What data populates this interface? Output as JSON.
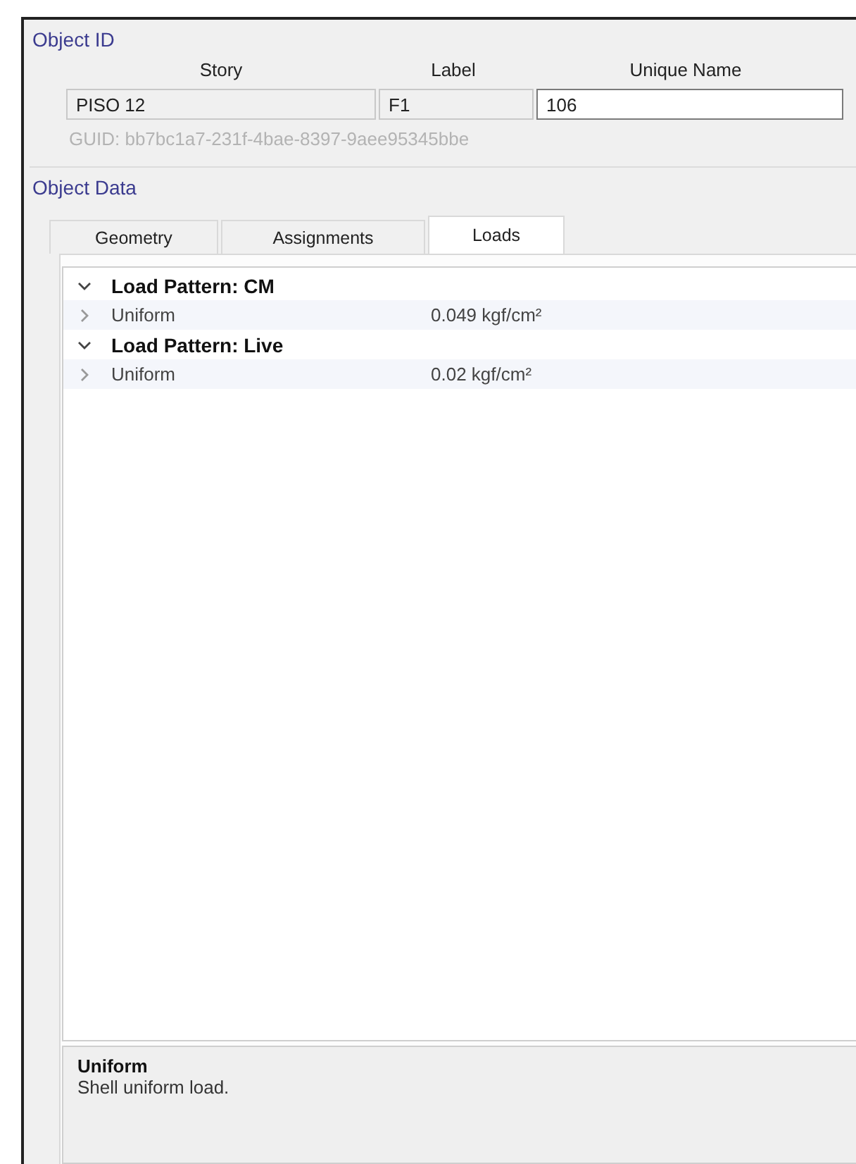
{
  "object_id": {
    "title": "Object ID",
    "columns": [
      "Story",
      "Label",
      "Unique Name"
    ],
    "fields": [
      {
        "value": "PISO 12",
        "editable": false
      },
      {
        "value": "F1",
        "editable": false
      },
      {
        "value": "106",
        "editable": true
      }
    ],
    "guid": "GUID: bb7bc1a7-231f-4bae-8397-9aee95345bbe"
  },
  "object_data": {
    "title": "Object Data",
    "tabs": [
      {
        "label": "Geometry",
        "selected": false
      },
      {
        "label": "Assignments",
        "selected": false
      },
      {
        "label": "Loads",
        "selected": true
      }
    ],
    "tree": [
      {
        "label": "Load Pattern: CM",
        "expanded": true,
        "children": [
          {
            "label": "Uniform",
            "value": "0.049 kgf/cm²",
            "expanded": false
          }
        ]
      },
      {
        "label": "Load Pattern: Live",
        "expanded": true,
        "children": [
          {
            "label": "Uniform",
            "value": "0.02 kgf/cm²",
            "expanded": false
          }
        ]
      }
    ],
    "description": {
      "title": "Uniform",
      "text": "Shell uniform load."
    }
  }
}
